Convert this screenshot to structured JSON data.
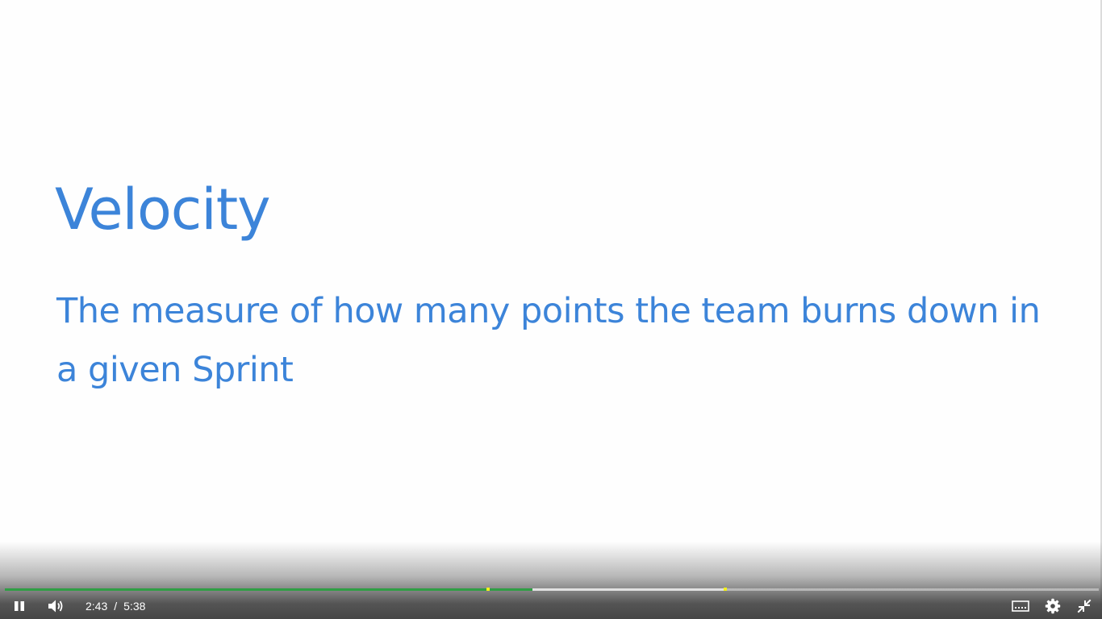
{
  "slide": {
    "title": "Velocity",
    "body": "The measure of how many points the team burns down in a given Sprint",
    "text_color": "#3c84d9"
  },
  "player": {
    "current_time": "2:43",
    "time_separator": "/",
    "duration": "5:38",
    "progress_fraction": 0.482,
    "buffered_fraction": 0.66,
    "played_color": "#2f9e44",
    "marker_color": "#f3f21a",
    "marker_fractions": [
      0.44,
      0.657
    ],
    "controls": {
      "play_pause": "pause-icon",
      "volume": "volume-icon",
      "captions": "captions-icon",
      "settings": "gear-icon",
      "fullscreen": "exit-fullscreen-icon"
    }
  }
}
